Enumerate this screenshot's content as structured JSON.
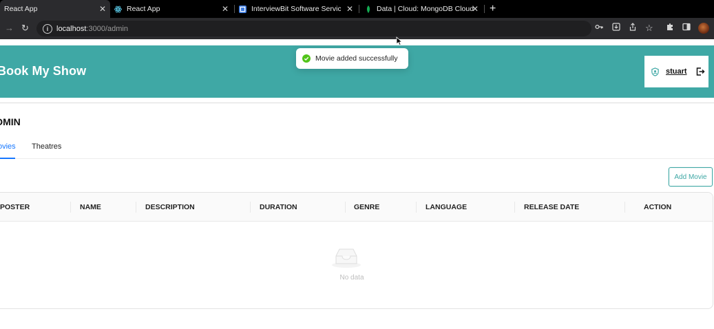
{
  "browser": {
    "tabs": [
      {
        "title": "React App",
        "active": true
      },
      {
        "title": "React App",
        "active": false
      },
      {
        "title": "InterviewBit Software Services",
        "active": false
      },
      {
        "title": "Data | Cloud: MongoDB Cloud",
        "active": false
      }
    ],
    "address": {
      "host": "localhost",
      "path": ":3000/admin"
    }
  },
  "header": {
    "brand": "Book My Show",
    "username": "stuart"
  },
  "toast": {
    "message": "Movie added successfully",
    "color": "#52c41a"
  },
  "admin": {
    "title": "DMIN",
    "tabs": [
      {
        "label": "ovies",
        "active": true
      },
      {
        "label": "Theatres",
        "active": false
      }
    ],
    "add_button": "Add Movie",
    "columns": [
      "POSTER",
      "NAME",
      "DESCRIPTION",
      "DURATION",
      "GENRE",
      "LANGUAGE",
      "RELEASE DATE",
      "ACTION"
    ],
    "rows": [],
    "empty_text": "No data"
  },
  "colors": {
    "brand": "#3fa8a5",
    "accent": "#1677ff"
  },
  "icons": {
    "user": "shield-user-icon",
    "logout": "logout-icon",
    "success": "check-circle-icon",
    "empty": "inbox-icon"
  }
}
